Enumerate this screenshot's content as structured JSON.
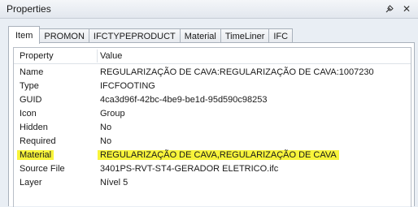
{
  "window": {
    "title": "Properties"
  },
  "tabs": [
    {
      "label": "Item",
      "active": true
    },
    {
      "label": "PROMON",
      "active": false
    },
    {
      "label": "IFCTYPEPRODUCT",
      "active": false
    },
    {
      "label": "Material",
      "active": false
    },
    {
      "label": "TimeLiner",
      "active": false
    },
    {
      "label": "IFC",
      "active": false
    }
  ],
  "table": {
    "columns": [
      "Property",
      "Value"
    ],
    "rows": [
      {
        "property": "Name",
        "value": "REGULARIZAÇÃO DE CAVA:REGULARIZAÇÃO DE CAVA:1007230"
      },
      {
        "property": "Type",
        "value": "IFCFOOTING"
      },
      {
        "property": "GUID",
        "value": "4ca3d96f-42bc-4be9-be1d-95d590c98253"
      },
      {
        "property": "Icon",
        "value": "Group"
      },
      {
        "property": "Hidden",
        "value": "No"
      },
      {
        "property": "Required",
        "value": "No"
      },
      {
        "property": "Material",
        "value": "REGULARIZAÇÃO DE CAVA,REGULARIZAÇÃO DE CAVA",
        "highlighted": true
      },
      {
        "property": "Source File",
        "value": "3401PS-RVT-ST4-GERADOR ELETRICO.ifc"
      },
      {
        "property": "Layer",
        "value": "Nível 5"
      }
    ]
  },
  "colors": {
    "highlight": "#f8f43a",
    "chrome": "#e9eef4"
  },
  "icons": [
    "pin-icon",
    "close-icon"
  ]
}
